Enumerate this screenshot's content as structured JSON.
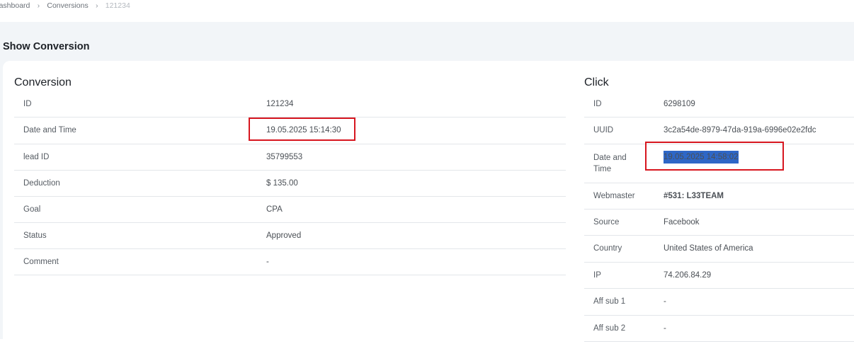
{
  "breadcrumb": {
    "items": [
      "Dashboard",
      "Conversions"
    ],
    "current": "121234",
    "separator_icon": "chevron-right-icon"
  },
  "page": {
    "title": "Show Conversion"
  },
  "conversion": {
    "title": "Conversion",
    "rows": [
      {
        "label": "ID",
        "value": "121234"
      },
      {
        "label": "Date and Time",
        "value": "19.05.2025 15:14:30"
      },
      {
        "label": "lead ID",
        "value": "35799553"
      },
      {
        "label": "Deduction",
        "value": "$ 135.00"
      },
      {
        "label": "Goal",
        "value": "CPA"
      },
      {
        "label": "Status",
        "value": "Approved"
      },
      {
        "label": "Comment",
        "value": "-"
      }
    ]
  },
  "click": {
    "title": "Click",
    "rows": [
      {
        "label": "ID",
        "value": "6298109"
      },
      {
        "label": "UUID",
        "value": "3c2a54de-8979-47da-919a-6996e02e2fdc"
      },
      {
        "label": "Date and Time",
        "value": "19.05.2025 14:58:02"
      },
      {
        "label": "Webmaster",
        "value": "#531: L33TEAM"
      },
      {
        "label": "Source",
        "value": "Facebook"
      },
      {
        "label": "Country",
        "value": "United States of America"
      },
      {
        "label": "IP",
        "value": "74.206.84.29"
      },
      {
        "label": "Aff sub 1",
        "value": "-"
      },
      {
        "label": "Aff sub 2",
        "value": "-"
      }
    ]
  },
  "colors": {
    "highlight_box": "#d7161f",
    "selection": "#2e67c7",
    "link": "#2f74c5"
  }
}
